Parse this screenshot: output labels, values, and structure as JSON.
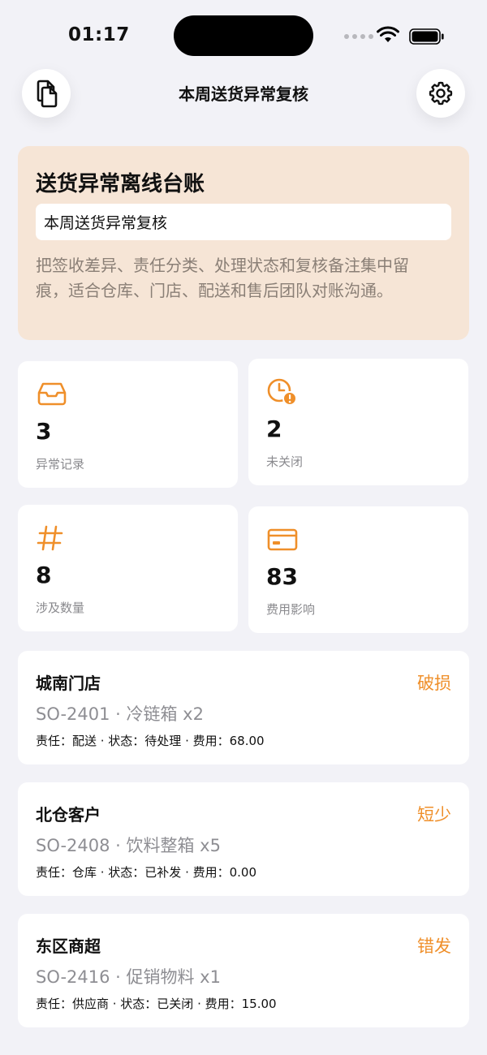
{
  "status_bar": {
    "time": "01:17"
  },
  "nav": {
    "title": "本周送货异常复核",
    "left_icon": "copy-documents-icon",
    "right_icon": "gear-icon"
  },
  "hero": {
    "title": "送货异常离线台账",
    "input_value": "本周送货异常复核",
    "description": "把签收差异、责任分类、处理状态和复核备注集中留痕，适合仓库、门店、配送和售后团队对账沟通。"
  },
  "stats": [
    {
      "icon": "inbox-tray-icon",
      "value": "3",
      "label": "异常记录"
    },
    {
      "icon": "clock-alert-icon",
      "value": "2",
      "label": "未关闭"
    },
    {
      "icon": "hash-icon",
      "value": "8",
      "label": "涉及数量"
    },
    {
      "icon": "credit-card-icon",
      "value": "83",
      "label": "费用影响"
    }
  ],
  "records": [
    {
      "name": "城南门店",
      "type": "破损",
      "sub": "SO-2401 · 冷链箱 x2",
      "meta": "责任：配送 · 状态：待处理 · 费用：68.00"
    },
    {
      "name": "北仓客户",
      "type": "短少",
      "sub": "SO-2408 · 饮料整箱 x5",
      "meta": "责任：仓库 · 状态：已补发 · 费用：0.00"
    },
    {
      "name": "东区商超",
      "type": "错发",
      "sub": "SO-2416 · 促销物料 x1",
      "meta": "责任：供应商 · 状态：已关闭 · 费用：15.00"
    }
  ],
  "colors": {
    "accent": "#ef8f2a",
    "hero_bg": "#f6e5d6",
    "page_bg": "#f2f2f7"
  }
}
